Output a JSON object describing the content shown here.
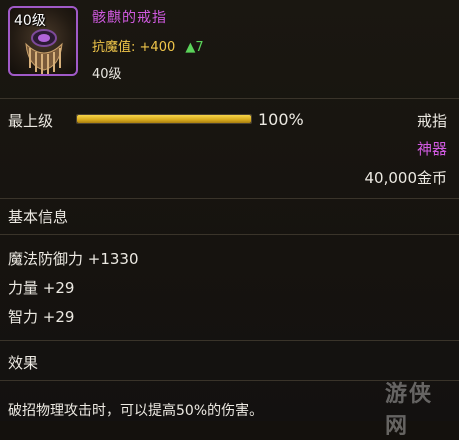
{
  "header": {
    "icon_level": "40级",
    "item_name": "骸麒的戒指",
    "resist_label": "抗魔值:",
    "resist_value": "+400",
    "resist_delta": "▲7",
    "required_level": "40级"
  },
  "info_row": {
    "top_level_label": "最上级",
    "progress_percent": "100%",
    "progress_fraction": 1.0,
    "slot": "戒指",
    "rarity": "神器",
    "price": "40,000金币"
  },
  "basic_info": {
    "title": "基本信息",
    "stats": [
      "魔法防御力 +1330",
      "力量 +29",
      "智力 +29"
    ]
  },
  "effect": {
    "title": "效果",
    "text": "破招物理攻击时，可以提高50%的伤害。"
  },
  "watermark": "游侠网",
  "colors": {
    "rare_purple": "#d05ae0",
    "gold": "#f0c64a",
    "up_green": "#5bd35a",
    "bar_gold": "#f7d64a"
  }
}
